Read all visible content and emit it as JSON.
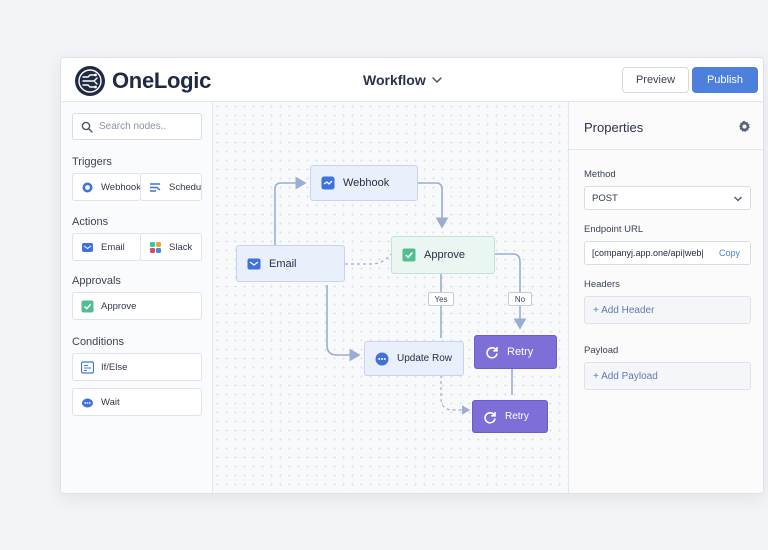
{
  "header": {
    "brand": "OneLogic",
    "workflow_title": "Workflow",
    "preview_label": "Preview",
    "publish_label": "Publish",
    "accent_color": "#4d7fdc"
  },
  "sidebar": {
    "search_placeholder": "Search nodes..",
    "sections": {
      "triggers": {
        "title": "Triggers",
        "items": [
          "Webhook",
          "Schedule"
        ]
      },
      "actions": {
        "title": "Actions",
        "items": [
          "Email",
          "Slack"
        ]
      },
      "approvals": {
        "title": "Approvals",
        "items": [
          "Approve"
        ]
      },
      "conditions": {
        "title": "Conditions",
        "items": [
          "If/Else",
          "Wait"
        ]
      }
    }
  },
  "canvas": {
    "nodes": {
      "webhook": "Webhook",
      "email": "Email",
      "approve": "Approve",
      "update_row": "Update Row",
      "retry_1": "Retry",
      "retry_2": "Retry"
    },
    "branch_labels": {
      "yes": "Yes",
      "no": "No"
    }
  },
  "properties": {
    "title": "Properties",
    "method_label": "Method",
    "method_value": "POST",
    "endpoint_label": "Endpoint URL",
    "endpoint_value": "[companyj.app.one/api|web|",
    "copy_label": "Copy",
    "headers_label": "Headers",
    "add_header": "+ Add Header",
    "payload_label": "Payload",
    "add_payload": "+ Add Payload"
  }
}
